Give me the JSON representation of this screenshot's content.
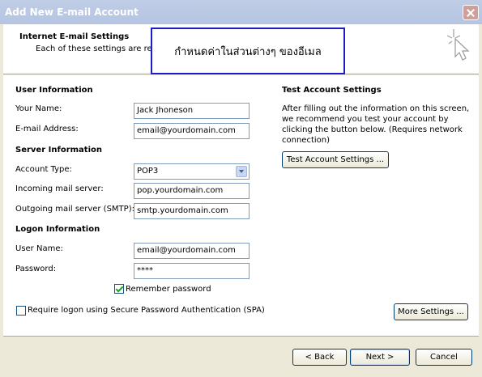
{
  "window": {
    "title": "Add New E-mail Account"
  },
  "header": {
    "title": "Internet E-mail Settings",
    "subtitle": "Each of these settings are req"
  },
  "callout": {
    "text": "กำหนดค่าในส่วนต่างๆ ของอีเมล"
  },
  "user_info": {
    "heading": "User Information",
    "name_label": "Your Name:",
    "name_value": "Jack Jhoneson",
    "email_label": "E-mail Address:",
    "email_value": "email@yourdomain.com"
  },
  "server_info": {
    "heading": "Server Information",
    "account_type_label": "Account Type:",
    "account_type_value": "POP3",
    "incoming_label": "Incoming mail server:",
    "incoming_value": "pop.yourdomain.com",
    "outgoing_label": "Outgoing mail server (SMTP):",
    "outgoing_value": "smtp.yourdomain.com"
  },
  "logon_info": {
    "heading": "Logon Information",
    "username_label": "User Name:",
    "username_value": "email@yourdomain.com",
    "password_label": "Password:",
    "password_value": "****",
    "remember_label": "Remember password",
    "remember_checked": true,
    "spa_label": "Require logon using Secure Password Authentication (SPA)",
    "spa_checked": false
  },
  "test_settings": {
    "heading": "Test Account Settings",
    "description": "After filling out the information on this screen, we recommend you test your account by clicking the button below. (Requires network connection)",
    "test_button": "Test Account Settings ..."
  },
  "more_settings_button": "More Settings ...",
  "footer": {
    "back": "< Back",
    "next": "Next >",
    "cancel": "Cancel"
  }
}
